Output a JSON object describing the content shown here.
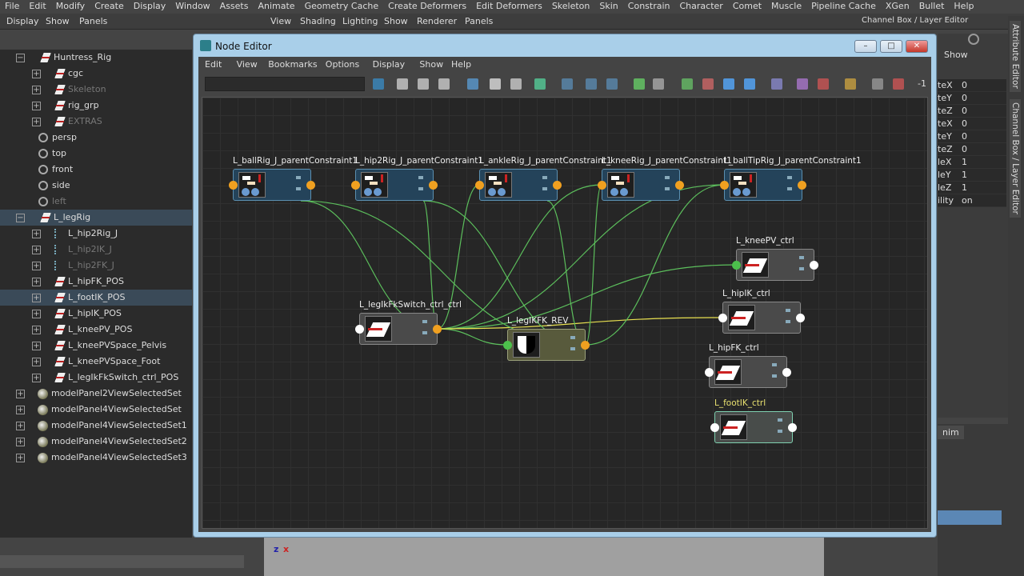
{
  "menubar": [
    "File",
    "Edit",
    "Modify",
    "Create",
    "Display",
    "Window",
    "Assets",
    "Animate",
    "Geometry Cache",
    "Create Deformers",
    "Edit Deformers",
    "Skeleton",
    "Skin",
    "Constrain",
    "Character",
    "Comet",
    "Muscle",
    "Pipeline Cache",
    "XGen",
    "Bullet",
    "Help"
  ],
  "outliner_menu": [
    "Display",
    "Show",
    "Panels"
  ],
  "viewport_menu": [
    "View",
    "Shading",
    "Lighting",
    "Show",
    "Renderer",
    "Panels"
  ],
  "channel_box_title": "Channel Box / Layer Editor",
  "outliner": [
    {
      "label": "Huntress_Rig",
      "icon": "transform",
      "expand": "-",
      "indent": 0
    },
    {
      "label": "cgc",
      "icon": "transform",
      "expand": "+",
      "indent": 1
    },
    {
      "label": "Skeleton",
      "icon": "transform",
      "expand": "+",
      "indent": 1,
      "dim": true
    },
    {
      "label": "rig_grp",
      "icon": "transform",
      "expand": "+",
      "indent": 1
    },
    {
      "label": "EXTRAS",
      "icon": "transform",
      "expand": "+",
      "indent": 1,
      "dim": true
    },
    {
      "label": "persp",
      "icon": "camera",
      "indent": 0
    },
    {
      "label": "top",
      "icon": "camera",
      "indent": 0
    },
    {
      "label": "front",
      "icon": "camera",
      "indent": 0
    },
    {
      "label": "side",
      "icon": "camera",
      "indent": 0
    },
    {
      "label": "left",
      "icon": "camera",
      "indent": 0,
      "dim": true
    },
    {
      "label": "L_legRig",
      "icon": "transform",
      "expand": "-",
      "indent": 0,
      "selected": true
    },
    {
      "label": "L_hip2Rig_J",
      "icon": "joint",
      "expand": "+",
      "indent": 1
    },
    {
      "label": "L_hip2IK_J",
      "icon": "joint",
      "expand": "+",
      "indent": 1,
      "dim": true
    },
    {
      "label": "L_hip2FK_J",
      "icon": "joint",
      "expand": "+",
      "indent": 1,
      "dim": true
    },
    {
      "label": "L_hipFK_POS",
      "icon": "transform",
      "expand": "+",
      "indent": 1
    },
    {
      "label": "L_footIK_POS",
      "icon": "transform",
      "expand": "+",
      "indent": 1,
      "selected": true
    },
    {
      "label": "L_hipIK_POS",
      "icon": "transform",
      "expand": "+",
      "indent": 1
    },
    {
      "label": "L_kneePV_POS",
      "icon": "transform",
      "expand": "+",
      "indent": 1
    },
    {
      "label": "L_kneePVSpace_Pelvis",
      "icon": "transform",
      "expand": "+",
      "indent": 1
    },
    {
      "label": "L_kneePVSpace_Foot",
      "icon": "transform",
      "expand": "+",
      "indent": 1
    },
    {
      "label": "L_legIkFkSwitch_ctrl_POS",
      "icon": "transform",
      "expand": "+",
      "indent": 1
    },
    {
      "label": "modelPanel2ViewSelectedSet",
      "icon": "set",
      "expand": "+",
      "indent": 0
    },
    {
      "label": "modelPanel4ViewSelectedSet",
      "icon": "set",
      "expand": "+",
      "indent": 0
    },
    {
      "label": "modelPanel4ViewSelectedSet1",
      "icon": "set",
      "expand": "+",
      "indent": 0
    },
    {
      "label": "modelPanel4ViewSelectedSet2",
      "icon": "set",
      "expand": "+",
      "indent": 0
    },
    {
      "label": "modelPanel4ViewSelectedSet3",
      "icon": "set",
      "expand": "+",
      "indent": 0
    }
  ],
  "node_editor": {
    "title": "Node Editor",
    "menu": [
      "Edit",
      "View",
      "Bookmarks",
      "Options",
      "Display",
      "Show",
      "Help"
    ],
    "toolbar_end": "-1",
    "nodes": [
      {
        "id": "ballRig",
        "label": "L_ballRig_J_parentConstraint1",
        "type": "constraint"
      },
      {
        "id": "hip2Rig",
        "label": "L_hip2Rig_J_parentConstraint1",
        "type": "constraint"
      },
      {
        "id": "ankleRig",
        "label": "L_ankleRig_J_parentConstraint1",
        "type": "constraint"
      },
      {
        "id": "kneeRig",
        "label": "L_kneeRig_J_parentConstraint1",
        "type": "constraint"
      },
      {
        "id": "ballTipRig",
        "label": "L_ballTipRig_J_parentConstraint1",
        "type": "constraint"
      },
      {
        "id": "kneePV",
        "label": "L_kneePV_ctrl",
        "type": "control"
      },
      {
        "id": "hipIK",
        "label": "L_hipIK_ctrl",
        "type": "control"
      },
      {
        "id": "hipFK",
        "label": "L_hipFK_ctrl",
        "type": "control"
      },
      {
        "id": "footIK",
        "label": "L_footIK_ctrl",
        "type": "control",
        "selected": true
      },
      {
        "id": "switch",
        "label": "L_legIkFkSwitch_ctrl_ctrl",
        "type": "control"
      },
      {
        "id": "rev",
        "label": "L_legIKFK_REV",
        "type": "reverse"
      }
    ]
  },
  "channel_box": {
    "show_label": "Show",
    "rows": [
      {
        "name": "teX",
        "value": "0"
      },
      {
        "name": "teY",
        "value": "0"
      },
      {
        "name": "teZ",
        "value": "0"
      },
      {
        "name": "teX",
        "value": "0"
      },
      {
        "name": "teY",
        "value": "0"
      },
      {
        "name": "teZ",
        "value": "0"
      },
      {
        "name": "leX",
        "value": "1"
      },
      {
        "name": "leY",
        "value": "1"
      },
      {
        "name": "leZ",
        "value": "1"
      },
      {
        "name": "ility",
        "value": "on"
      }
    ]
  },
  "side_tabs": [
    "Attribute Editor",
    "Channel Box / Layer Editor"
  ],
  "layer_tab": "nim",
  "axis": {
    "z": "z",
    "x": "x"
  },
  "colors": {
    "constraint": "#24435a",
    "port_orange": "#f0a020",
    "port_green": "#4cc04c",
    "connection_green": "#5cbf5c",
    "connection_yellow": "#e8e050",
    "window_frame": "#a9cfe9"
  }
}
